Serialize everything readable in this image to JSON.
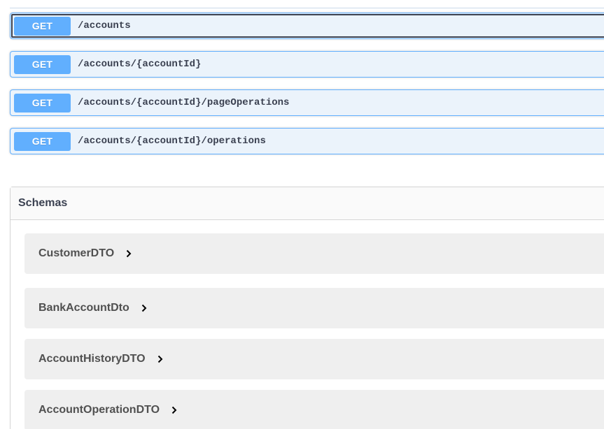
{
  "operations": [
    {
      "method": "GET",
      "path": "/accounts"
    },
    {
      "method": "GET",
      "path": "/accounts/{accountId}"
    },
    {
      "method": "GET",
      "path": "/accounts/{accountId}/pageOperations"
    },
    {
      "method": "GET",
      "path": "/accounts/{accountId}/operations"
    }
  ],
  "schemas": {
    "title": "Schemas",
    "items": [
      {
        "name": "CustomerDTO"
      },
      {
        "name": "BankAccountDto"
      },
      {
        "name": "AccountHistoryDTO"
      },
      {
        "name": "AccountOperationDTO"
      }
    ]
  },
  "colors": {
    "get_accent": "#61affe",
    "get_background": "#ebf3fb",
    "schema_row_background": "#efefef"
  },
  "icons": {
    "schema_expand": "chevron-right-icon"
  }
}
